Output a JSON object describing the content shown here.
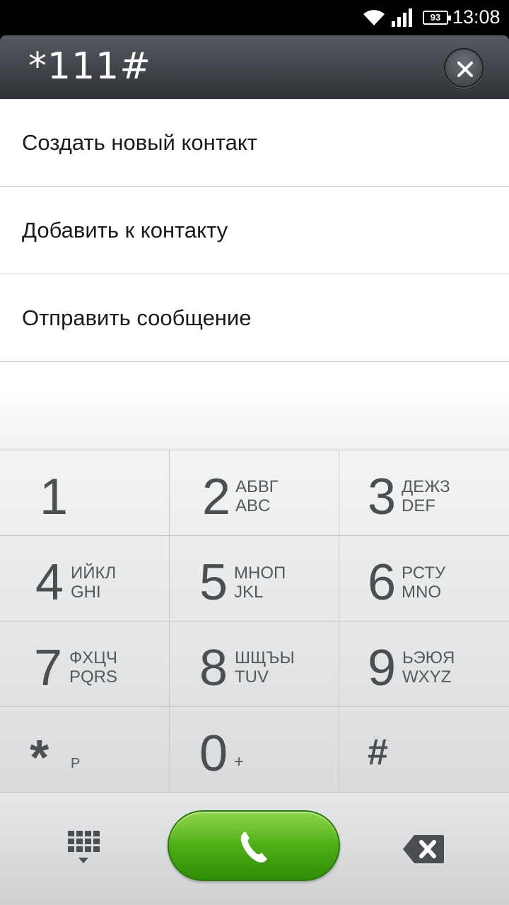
{
  "status_bar": {
    "battery": "93",
    "time": "13:08",
    "icons": [
      "wifi-icon",
      "signal-icon",
      "battery-icon"
    ]
  },
  "dialer": {
    "number": "*111#",
    "clear_icon": "close-icon"
  },
  "menu": {
    "items": [
      {
        "label": "Создать новый контакт"
      },
      {
        "label": "Добавить к контакту"
      },
      {
        "label": "Отправить сообщение"
      }
    ]
  },
  "keypad": {
    "keys": [
      {
        "digit": "1",
        "line1": "",
        "line2": ""
      },
      {
        "digit": "2",
        "line1": "АБВГ",
        "line2": "ABC"
      },
      {
        "digit": "3",
        "line1": "ДЕЖЗ",
        "line2": "DEF"
      },
      {
        "digit": "4",
        "line1": "ИЙКЛ",
        "line2": "GHI"
      },
      {
        "digit": "5",
        "line1": "МНОП",
        "line2": "JKL"
      },
      {
        "digit": "6",
        "line1": "РСТУ",
        "line2": "MNO"
      },
      {
        "digit": "7",
        "line1": "ФХЦЧ",
        "line2": "PQRS"
      },
      {
        "digit": "8",
        "line1": "ШЩЪЫ",
        "line2": "TUV"
      },
      {
        "digit": "9",
        "line1": "ЬЭЮЯ",
        "line2": "WXYZ"
      },
      {
        "digit": "*",
        "line1": "",
        "line2": "P"
      },
      {
        "digit": "0",
        "line1": "",
        "line2": "+"
      },
      {
        "digit": "#",
        "line1": "",
        "line2": ""
      }
    ]
  },
  "bottom_bar": {
    "left_icon": "dialpad-icon",
    "call_icon": "phone-icon",
    "right_icon": "backspace-icon",
    "call_color": "#4fae16"
  }
}
